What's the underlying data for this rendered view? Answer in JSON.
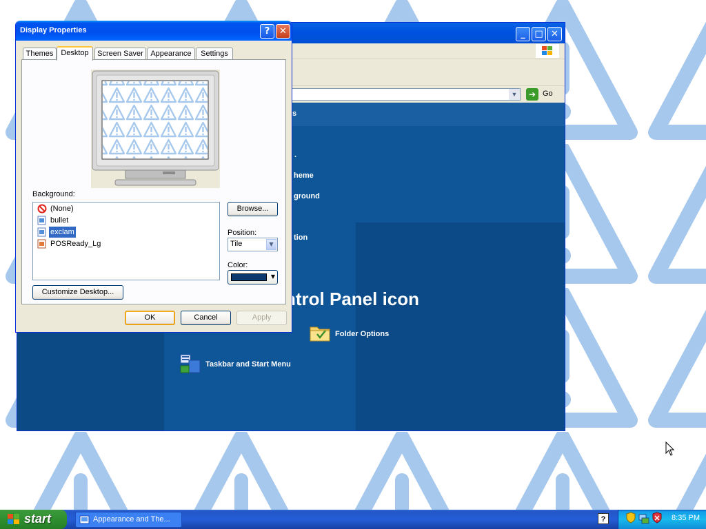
{
  "background_window": {
    "controls": {
      "minimize": "_",
      "maximize": "□",
      "close": "✕"
    },
    "address_go": "Go",
    "partial_links": [
      "s",
      ".",
      "heme",
      "ground",
      "tion"
    ],
    "heading_fragment": "ntrol Panel icon",
    "items": [
      {
        "label": "Folder Options",
        "icon": "folder-options-icon"
      },
      {
        "label": "Taskbar and Start Menu",
        "icon": "taskbar-start-menu-icon"
      }
    ]
  },
  "dialog": {
    "title": "Display Properties",
    "help_glyph": "?",
    "close_glyph": "✕",
    "tabs": [
      {
        "label": "Themes",
        "active": false
      },
      {
        "label": "Desktop",
        "active": true
      },
      {
        "label": "Screen Saver",
        "active": false
      },
      {
        "label": "Appearance",
        "active": false
      },
      {
        "label": "Settings",
        "active": false
      }
    ],
    "background_label": "Background:",
    "backgrounds": [
      {
        "label": "(None)",
        "icon": "none-icon",
        "selected": false
      },
      {
        "label": "bullet",
        "icon": "image-file-icon",
        "selected": false
      },
      {
        "label": "exclam",
        "icon": "image-file-icon",
        "selected": true
      },
      {
        "label": "POSReady_Lg",
        "icon": "image-file-icon",
        "selected": false
      }
    ],
    "browse_label": "Browse...",
    "position_label": "Position:",
    "position_value": "Tile",
    "color_label": "Color:",
    "color_value": "#0b3a70",
    "customize_label": "Customize Desktop...",
    "ok_label": "OK",
    "cancel_label": "Cancel",
    "apply_label": "Apply"
  },
  "taskbar": {
    "start_label": "start",
    "task_label": "Appearance and The...",
    "help_glyph": "?",
    "clock": "8:35 PM"
  },
  "colors": {
    "wallpaper_symbol": "#a6c8ec",
    "dialog_title": "#0053ee",
    "selection": "#316ac5"
  }
}
